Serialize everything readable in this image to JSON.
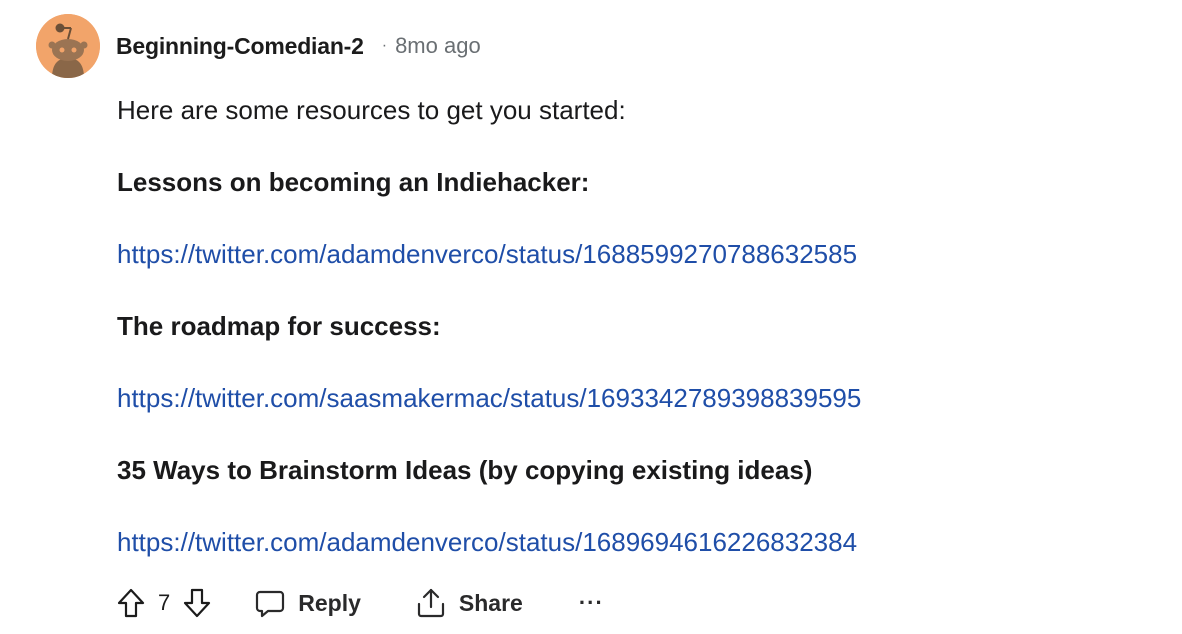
{
  "comment": {
    "author": "Beginning-Comedian-2",
    "separator": "·",
    "time": "8mo ago",
    "avatar_icon": "snoo-avatar-icon",
    "avatar_color": "#f2a46a"
  },
  "body": {
    "intro": "Here are some resources to get you started:",
    "heading1": "Lessons on becoming an Indiehacker:",
    "link1": "https://twitter.com/adamdenverco/status/1688599270788632585",
    "heading2": "The roadmap for success:",
    "link2": "https://twitter.com/saasmakermac/status/1693342789398839595",
    "heading3": "35 Ways to Brainstorm Ideas (by copying existing ideas)",
    "link3": "https://twitter.com/adamdenverco/status/1689694616226832384"
  },
  "actions": {
    "upvote_icon": "upvote-arrow-icon",
    "vote_count": "7",
    "downvote_icon": "downvote-arrow-icon",
    "reply_label": "Reply",
    "reply_icon": "speech-bubble-icon",
    "share_label": "Share",
    "share_icon": "share-upload-icon",
    "more_label": "···"
  },
  "colors": {
    "link": "#1f4ea8",
    "meta": "#6a6f73",
    "text": "#1a1a1b"
  }
}
